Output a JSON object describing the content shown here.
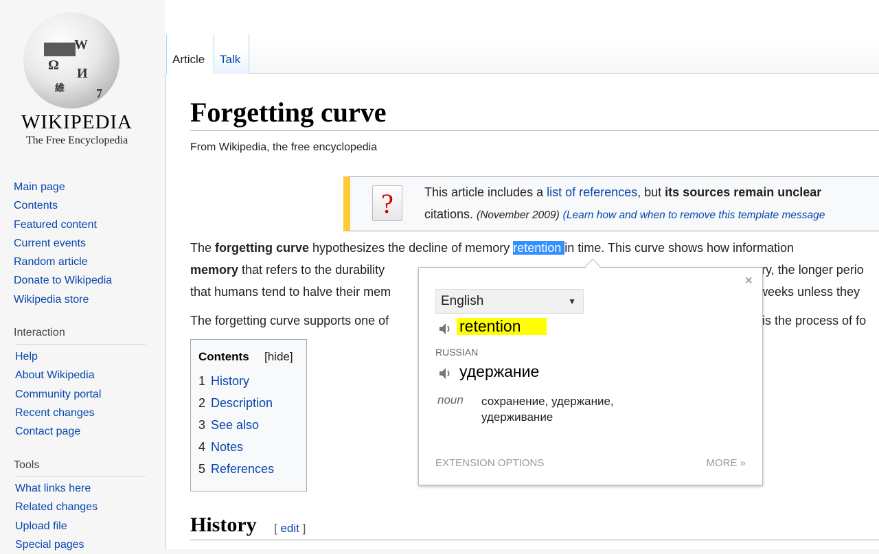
{
  "logo": {
    "wordmark": "WIKIPEDIA",
    "tagline": "The Free Encyclopedia",
    "glyphs": [
      "W",
      "Ω",
      "И",
      "維",
      "7"
    ]
  },
  "sidebar": {
    "main": [
      "Main page",
      "Contents",
      "Featured content",
      "Current events",
      "Random article",
      "Donate to Wikipedia",
      "Wikipedia store"
    ],
    "interaction_heading": "Interaction",
    "interaction": [
      "Help",
      "About Wikipedia",
      "Community portal",
      "Recent changes",
      "Contact page"
    ],
    "tools_heading": "Tools",
    "tools": [
      "What links here",
      "Related changes",
      "Upload file",
      "Special pages"
    ]
  },
  "tabs": {
    "article": "Article",
    "talk": "Talk"
  },
  "article": {
    "title": "Forgetting curve",
    "tagline": "From Wikipedia, the free encyclopedia",
    "ambox": {
      "icon": "?",
      "text_a": "This article includes a ",
      "link": "list of references",
      "text_b": ", but ",
      "bold": "its sources remain unclear",
      "line2_a": "citations. ",
      "date": "(November 2009)",
      "learn": "(Learn how and when to remove this template message"
    },
    "p1": {
      "l1_a": "The ",
      "l1_bold": "forgetting curve",
      "l1_b": " hypothesizes the decline of memory ",
      "l1_sel": "retention ",
      "l1_c": "in time. This curve shows how information",
      "l2_bold": "memory",
      "l2_a": " that refers to the durability",
      "l2_b": "ory, the longer perio",
      "l3_a": "that humans tend to halve their mem",
      "l3_b": "weeks unless they"
    },
    "p2": {
      "l1_a": "The forgetting curve supports one of",
      "l1_b": "is the process of fo"
    },
    "toc": {
      "title": "Contents",
      "hide": "[hide]",
      "items": [
        {
          "num": "1",
          "label": "History"
        },
        {
          "num": "2",
          "label": "Description"
        },
        {
          "num": "3",
          "label": "See also"
        },
        {
          "num": "4",
          "label": "Notes"
        },
        {
          "num": "5",
          "label": "References"
        }
      ]
    },
    "section": {
      "title": "History",
      "edit_open": "[ ",
      "edit": "edit",
      "edit_close": " ]"
    }
  },
  "translate_popup": {
    "close": "×",
    "source_language": "English",
    "caret": "▼",
    "source_word": "retention",
    "target_language": "RUSSIAN",
    "target_word": "удержание",
    "part_of_speech": "noun",
    "definitions": "сохранение, удержание, удерживание",
    "extension_options": "EXTENSION OPTIONS",
    "more": "MORE »"
  }
}
